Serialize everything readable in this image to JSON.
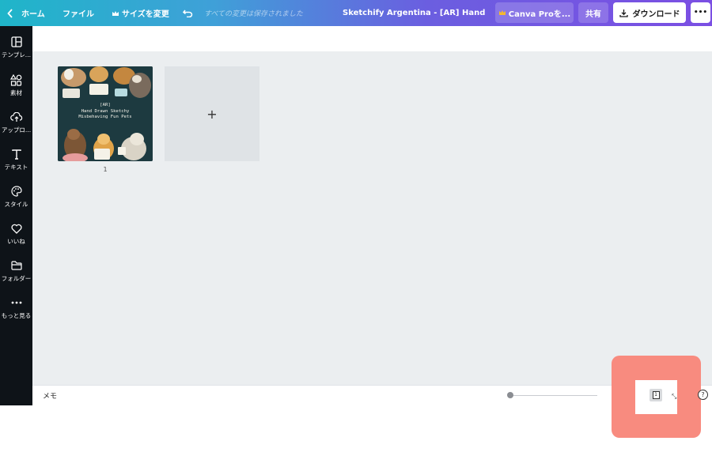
{
  "topbar": {
    "home_label": "ホーム",
    "file_label": "ファイル",
    "resize_label": "サイズを変更",
    "saved_status": "すべての変更は保存されました",
    "doc_title": "Sketchify Argentina - [AR] Hand Draw...",
    "pro_label": "Canva Proを...",
    "share_label": "共有",
    "download_label": "ダウンロード",
    "more_label": "•••"
  },
  "sidebar": {
    "items": [
      {
        "label": "テンプレ..."
      },
      {
        "label": "素材"
      },
      {
        "label": "アップロ..."
      },
      {
        "label": "テキスト"
      },
      {
        "label": "スタイル"
      },
      {
        "label": "いいね"
      },
      {
        "label": "フォルダー"
      },
      {
        "label": "もっと見る"
      }
    ]
  },
  "pages": {
    "thumb_text": [
      "[AR]",
      "Hand Drawn Sketchy",
      "Misbehaving Fun Pets"
    ],
    "page_number": "1",
    "add_symbol": "+"
  },
  "bottombar": {
    "memo_label": "メモ",
    "page_count": "1",
    "help_label": "?"
  },
  "colors": {
    "gradient_start": "#1fb5c9",
    "gradient_end": "#7b4fe3",
    "sidebar_bg": "#0e1318",
    "canvas_bg": "#ebeef0",
    "highlight": "#f88b7f"
  }
}
